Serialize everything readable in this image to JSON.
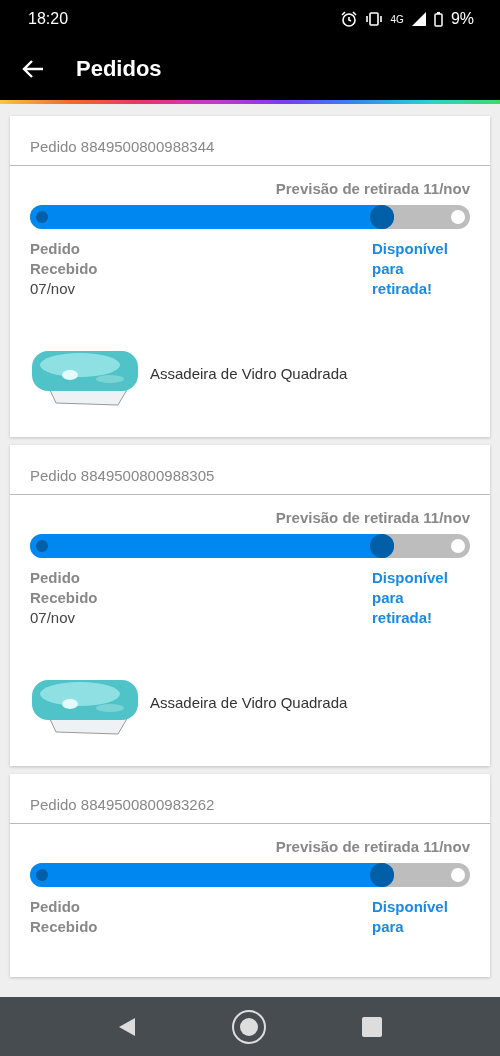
{
  "status_bar": {
    "time": "18:20",
    "network": "4G",
    "battery": "9%"
  },
  "app_bar": {
    "title": "Pedidos"
  },
  "orders": [
    {
      "title": "Pedido 8849500800988344",
      "forecast": "Previsão de retirada 11/nov",
      "level": 0.8,
      "start_label": [
        "Pedido",
        "Recebido"
      ],
      "start_date": "07/nov",
      "end_label": [
        "Disponível",
        "para",
        "retirada!"
      ],
      "product": {
        "name": "Assadeira de Vidro Quadrada",
        "kind": "picture"
      }
    },
    {
      "title": "Pedido 8849500800988305",
      "forecast": "Previsão de retirada 11/nov",
      "level": 0.8,
      "start_label": [
        "Pedido",
        "Recebido"
      ],
      "start_date": "07/nov",
      "end_label": [
        "Disponível",
        "para",
        "retirada!"
      ],
      "product": {
        "name": "Assadeira de Vidro Quadrada",
        "kind": "picture"
      }
    },
    {
      "title": "Pedido 8849500800983262",
      "forecast": "Previsão de retirada 11/nov",
      "level": 0.8,
      "start_label": [
        "Pedido",
        "Recebido"
      ],
      "end_label": [
        "Disponível",
        "para"
      ]
    }
  ]
}
